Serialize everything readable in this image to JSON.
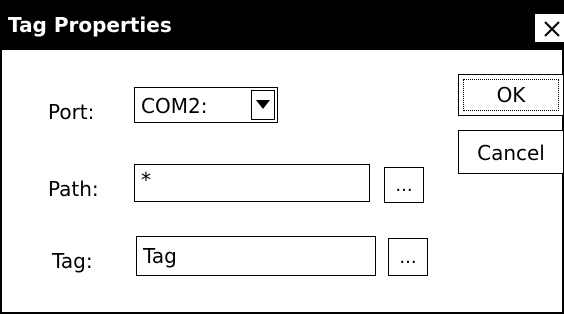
{
  "window": {
    "title": "Tag Properties",
    "close_glyph": "✕"
  },
  "form": {
    "port_label": "Port:",
    "port_value": "COM2:",
    "path_label": "Path:",
    "path_value": "*",
    "path_browse": "...",
    "tag_label": "Tag:",
    "tag_value": "Tag",
    "tag_browse": "..."
  },
  "buttons": {
    "ok": "OK",
    "cancel": "Cancel"
  },
  "colors": {
    "titlebar": "#000000",
    "background": "#ffffff",
    "text": "#000000"
  }
}
